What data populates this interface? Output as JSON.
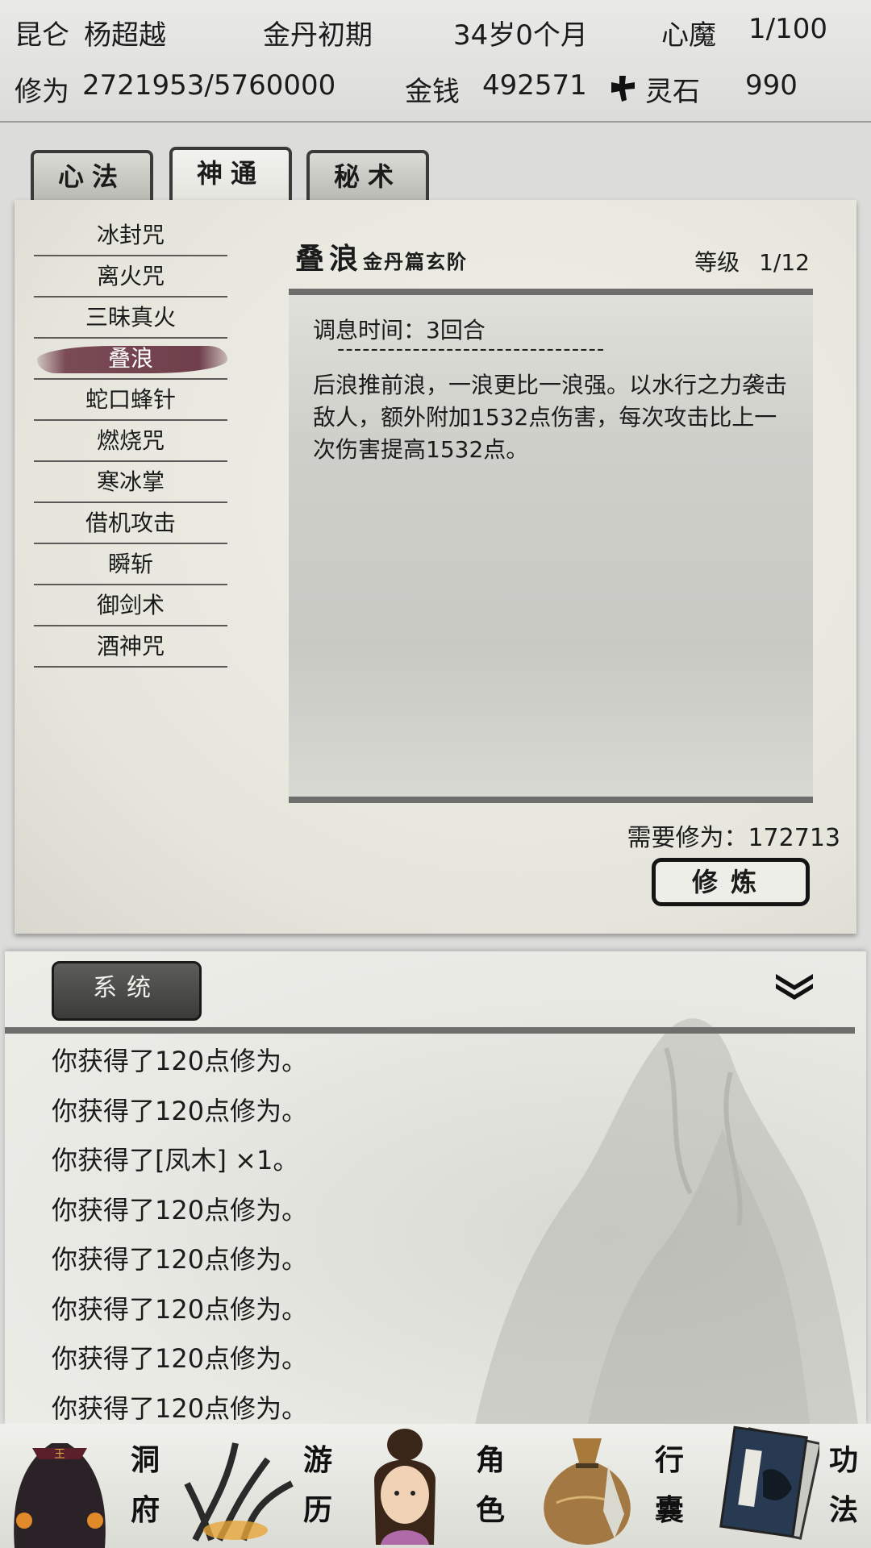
{
  "status": {
    "sect": "昆仑",
    "name": "杨超越",
    "realm": "金丹初期",
    "age": "34岁0个月",
    "demon_label": "心魔",
    "demon_value": "1/100",
    "cultivation_label": "修为",
    "cultivation_value": "2721953/5760000",
    "money_label": "金钱",
    "money_value": "492571",
    "spirit_stone_label": "灵石",
    "spirit_stone_value": "990"
  },
  "tabs": [
    {
      "label": "心法",
      "active": false
    },
    {
      "label": "神通",
      "active": true
    },
    {
      "label": "秘术",
      "active": false
    }
  ],
  "skills": [
    {
      "label": "冰封咒"
    },
    {
      "label": "离火咒"
    },
    {
      "label": "三昧真火"
    },
    {
      "label": "叠浪",
      "selected": true
    },
    {
      "label": "蛇口蜂针"
    },
    {
      "label": "燃烧咒"
    },
    {
      "label": "寒冰掌"
    },
    {
      "label": "借机攻击"
    },
    {
      "label": "瞬斩"
    },
    {
      "label": "御剑术"
    },
    {
      "label": "酒神咒"
    }
  ],
  "detail": {
    "name": "叠浪",
    "chapter": "金丹篇",
    "grade": "玄阶",
    "level_label": "等级",
    "level_value": "1/12",
    "cooldown": "调息时间：3回合",
    "dashes": "--------------------------------",
    "description": "后浪推前浪，一浪更比一浪强。以水行之力袭击敌人，额外附加1532点伤害，每次攻击比上一次伤害提高1532点。",
    "need_label": "需要修为：",
    "need_value": "172713",
    "train_button": "修炼"
  },
  "log": {
    "tab_label": "系统",
    "lines": [
      "你获得了120点修为。",
      "你获得了120点修为。",
      "你获得了[凤木] ×1。",
      "你获得了120点修为。",
      "你获得了120点修为。",
      "你获得了120点修为。",
      "你获得了120点修为。",
      "你获得了120点修为。"
    ]
  },
  "nav": [
    {
      "label1": "洞",
      "label2": "府",
      "icon": "cave-dwelling-icon"
    },
    {
      "label1": "游",
      "label2": "历",
      "icon": "travel-icon"
    },
    {
      "label1": "角",
      "label2": "色",
      "icon": "character-portrait-icon"
    },
    {
      "label1": "行",
      "label2": "囊",
      "icon": "inventory-bag-icon"
    },
    {
      "label1": "功",
      "label2": "法",
      "icon": "technique-book-icon"
    }
  ],
  "colors": {
    "selected_highlight": "#6f3f4b",
    "panel_bg": "#e5e5dc",
    "dark_button": "#3b3b39"
  }
}
